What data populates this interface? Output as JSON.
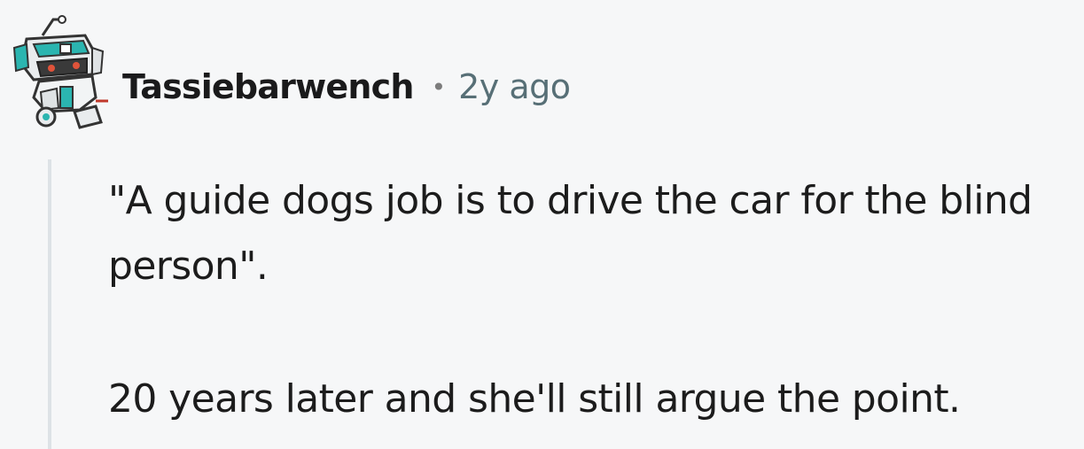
{
  "comment": {
    "username": "Tassiebarwench",
    "separator": "•",
    "timestamp": "2y ago",
    "avatar_icon": "robot-avatar-icon",
    "paragraphs": [
      "\"A guide dogs job is to drive the car for the blind person\".",
      "20 years later and she'll still argue the point."
    ]
  },
  "colors": {
    "background": "#f6f7f8",
    "username": "#1a1a1b",
    "timestamp": "#576f76",
    "body_text": "#1c1c1c",
    "thread_line": "#dde2e6",
    "avatar_accent": "#2bb5b0"
  }
}
